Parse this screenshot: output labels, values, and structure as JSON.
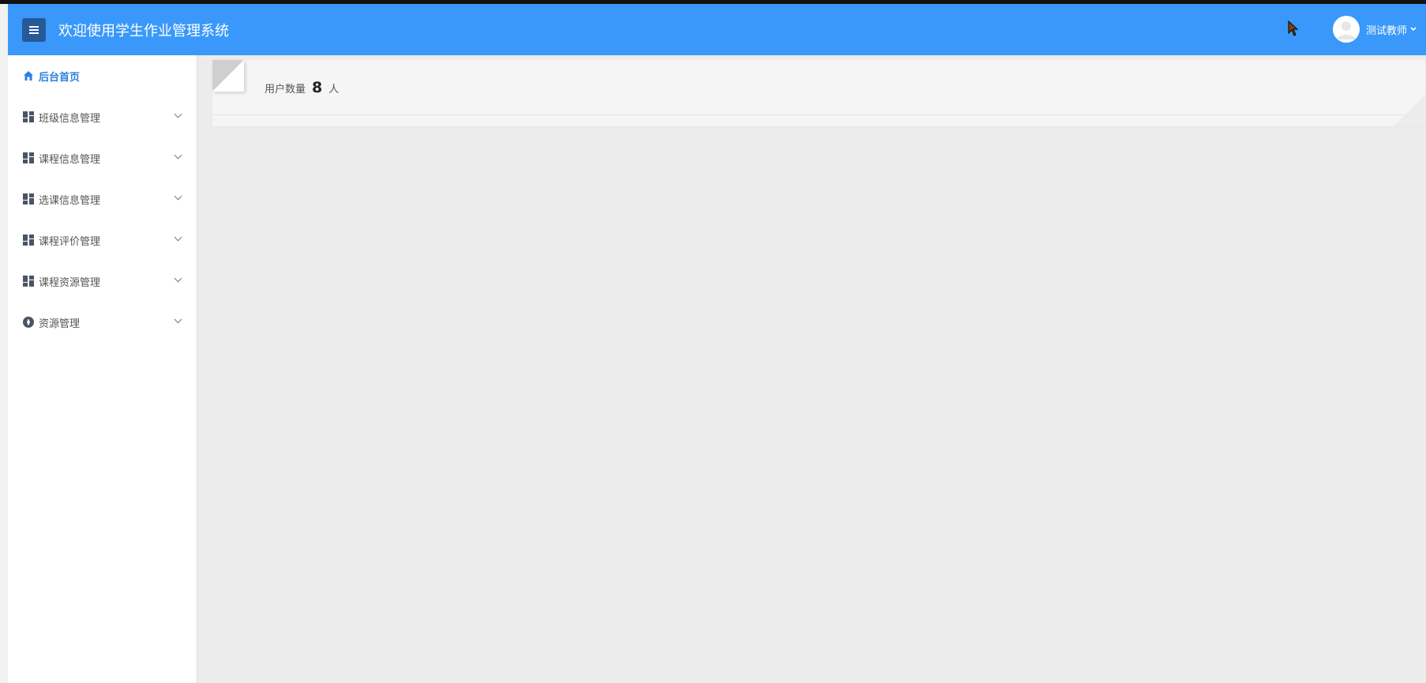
{
  "header": {
    "title": "欢迎使用学生作业管理系统",
    "user_name": "测试教师"
  },
  "sidebar": {
    "items": [
      {
        "label": "后台首页",
        "icon": "home-icon",
        "active": true
      },
      {
        "label": "班级信息管理",
        "icon": "dashboard-grid-icon"
      },
      {
        "label": "课程信息管理",
        "icon": "dashboard-grid-icon"
      },
      {
        "label": "选课信息管理",
        "icon": "dashboard-grid-icon"
      },
      {
        "label": "课程评价管理",
        "icon": "dashboard-grid-icon"
      },
      {
        "label": "课程资源管理",
        "icon": "dashboard-grid-icon"
      },
      {
        "label": "资源管理",
        "icon": "compass-icon"
      }
    ]
  },
  "dashboard": {
    "user_count_label": "用户数量",
    "user_count_value": "8",
    "user_count_unit": "人"
  },
  "colors": {
    "header_bg": "#3a98fa",
    "toggle_bg": "#265a96",
    "active_text": "#2c7fe0"
  }
}
